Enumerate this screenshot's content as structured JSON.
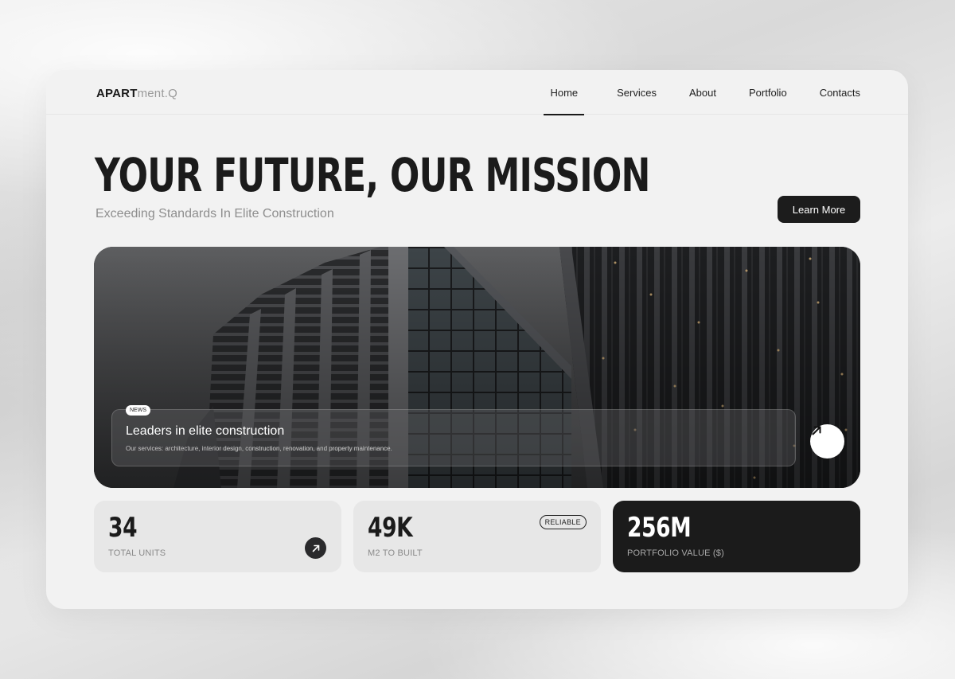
{
  "logo": {
    "bold": "APART",
    "light": "ment.Q"
  },
  "nav": {
    "items": [
      {
        "label": "Home",
        "active": true
      },
      {
        "label": "Services"
      },
      {
        "label": "About"
      },
      {
        "label": "Portfolio"
      },
      {
        "label": "Contacts"
      }
    ]
  },
  "hero": {
    "headline": "YOUR FUTURE, OUR MISSION",
    "subheadline": "Exceeding Standards In Elite Construction",
    "cta_label": "Learn More",
    "image_icon": "arrow-up-right-icon",
    "news": {
      "badge": "NEWS",
      "title": "Leaders in elite construction",
      "description": "Our services: architecture, interior design, construction, renovation, and property maintenance."
    }
  },
  "stats": [
    {
      "value": "34",
      "label": "TOTAL UNITS",
      "icon": "arrow-up-right-icon"
    },
    {
      "value": "49K",
      "label": "M2 TO BUILT",
      "badge": "RELIABLE"
    },
    {
      "value": "256M",
      "label": "PORTFOLIO VALUE ($)"
    }
  ],
  "colors": {
    "accent": "#1c1c1c",
    "card_bg": "#f2f2f2",
    "stat_bg": "#e7e7e7"
  }
}
